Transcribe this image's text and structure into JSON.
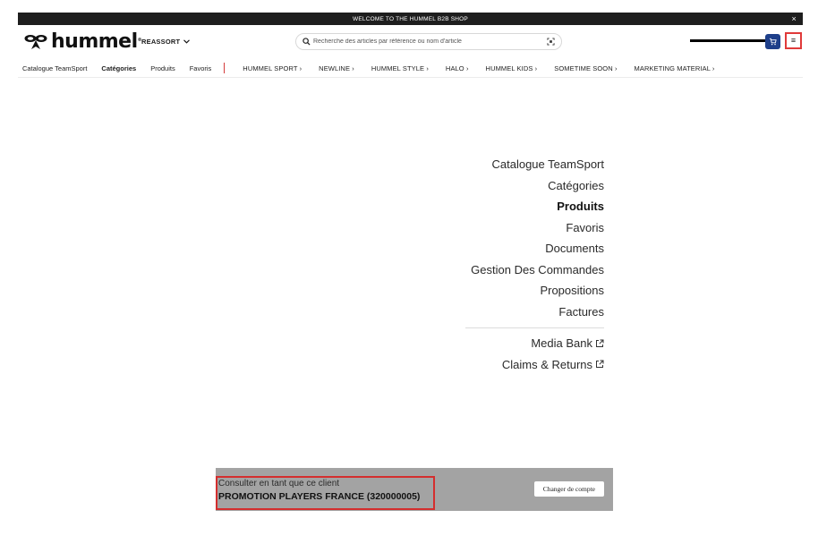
{
  "topbar": {
    "welcome": "WELCOME TO THE HUMMEL B2B SHOP",
    "close": "×"
  },
  "header": {
    "logo_text": "hummel",
    "logo_mark": "®",
    "reassort_label": "REASSORT",
    "search_placeholder": "Recherche des articles par référence ou nom d'article",
    "icons": {
      "search": "search-icon",
      "scan": "scan-icon",
      "cart": "cart-icon",
      "menu": "hamburger-menu-icon"
    },
    "menu_glyph": "≡",
    "accent": "#1e3f8a",
    "highlight": "#e03a3a"
  },
  "nav": {
    "catalogue": "Catalogue TeamSport",
    "categories": "Catégories",
    "produits": "Produits",
    "favoris": "Favoris",
    "brands": [
      "HUMMEL SPORT",
      "NEWLINE",
      "HUMMEL STYLE",
      "HALO",
      "HUMMEL KIDS",
      "SOMETIME SOON",
      "MARKETING MATERIAL"
    ],
    "chevron": "›"
  },
  "menu": {
    "items": [
      "Catalogue TeamSport",
      "Catégories",
      "Produits",
      "Favoris",
      "Documents",
      "Gestion Des Commandes",
      "Propositions",
      "Factures"
    ],
    "external": [
      "Media Bank",
      "Claims & Returns"
    ]
  },
  "client": {
    "label": "Consulter en tant que ce client",
    "name": "PROMOTION PLAYERS FRANCE (320000005)",
    "change_button": "Changer de compte"
  }
}
